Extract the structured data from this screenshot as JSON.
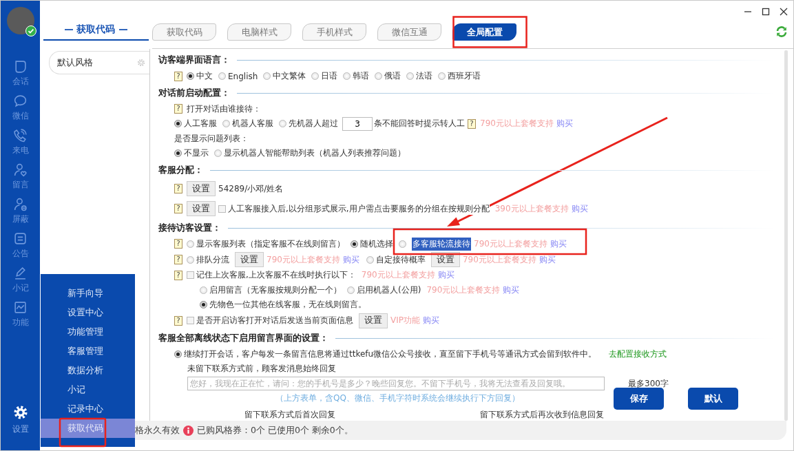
{
  "sidebar": {
    "items": [
      {
        "label": "会话"
      },
      {
        "label": "微信"
      },
      {
        "label": "来电"
      },
      {
        "label": "留言"
      },
      {
        "label": "屏蔽"
      },
      {
        "label": "公告"
      },
      {
        "label": "小记"
      },
      {
        "label": "功能"
      }
    ],
    "settings": {
      "label": "设置"
    }
  },
  "popup_menu": [
    {
      "label": "新手向导",
      "selected": false
    },
    {
      "label": "设置中心",
      "selected": false
    },
    {
      "label": "功能管理",
      "selected": false
    },
    {
      "label": "客服管理",
      "selected": false
    },
    {
      "label": "数据分析",
      "selected": false
    },
    {
      "label": "小记",
      "selected": false
    },
    {
      "label": "记录中心",
      "selected": false
    },
    {
      "label": "获取代码",
      "selected": true
    }
  ],
  "left_panel": {
    "title": "— 获取代码 —",
    "styles": [
      {
        "label": "默认风格"
      }
    ]
  },
  "tabs": [
    {
      "label": "获取代码",
      "selected": false
    },
    {
      "label": "电脑样式",
      "selected": false
    },
    {
      "label": "手机样式",
      "selected": false
    },
    {
      "label": "微信互通",
      "selected": false
    },
    {
      "label": "全局配置",
      "selected": true
    }
  ],
  "sections": [
    {
      "title": "访客端界面语言：",
      "rows": [
        {
          "kind": "main",
          "items": [
            {
              "kind": "help",
              "text": "?"
            },
            {
              "kind": "radio",
              "label": "中文",
              "selected": true
            },
            {
              "kind": "radio",
              "label": "English",
              "selected": false
            },
            {
              "kind": "radio",
              "label": "中文繁体",
              "selected": false
            },
            {
              "kind": "radio",
              "label": "日语",
              "selected": false
            },
            {
              "kind": "radio",
              "label": "韩语",
              "selected": false
            },
            {
              "kind": "radio",
              "label": "俄语",
              "selected": false
            },
            {
              "kind": "radio",
              "label": "法语",
              "selected": false
            },
            {
              "kind": "radio",
              "label": "西班牙语",
              "selected": false
            }
          ]
        }
      ]
    },
    {
      "title": "对话前启动配置：",
      "rows": [
        {
          "kind": "main",
          "items": [
            {
              "kind": "help",
              "text": "?"
            },
            {
              "kind": "text",
              "text": "打开对话由谁接待："
            }
          ]
        },
        {
          "kind": "main",
          "items": [
            {
              "kind": "radio",
              "label": "人工客服",
              "selected": true
            },
            {
              "kind": "radio",
              "label": "机器人客服",
              "selected": false
            },
            {
              "kind": "radio",
              "label": "先机器人超过",
              "selected": false
            },
            {
              "kind": "input",
              "value": "3"
            },
            {
              "kind": "text",
              "text": "条不能回答时提示转人工"
            },
            {
              "kind": "help",
              "text": "?"
            },
            {
              "kind": "promo",
              "text": "790元以上套餐支持"
            },
            {
              "kind": "link",
              "text": "购买"
            }
          ]
        },
        {
          "kind": "main",
          "items": [
            {
              "kind": "text",
              "text": "是否显示问题列表："
            }
          ]
        },
        {
          "kind": "main",
          "items": [
            {
              "kind": "radio",
              "label": "不显示",
              "selected": true
            },
            {
              "kind": "radio",
              "label": "显示机器人智能帮助列表（机器人列表推荐问题）",
              "selected": false
            }
          ]
        }
      ]
    },
    {
      "title": "客服分配：",
      "rows": [
        {
          "kind": "tall",
          "items": [
            {
              "kind": "help",
              "text": "?"
            },
            {
              "kind": "button",
              "label": "设置"
            },
            {
              "kind": "text",
              "text": "54289/小邓/姓名"
            }
          ]
        },
        {
          "kind": "tall",
          "items": [
            {
              "kind": "help",
              "text": "?"
            },
            {
              "kind": "button",
              "label": "设置"
            },
            {
              "kind": "checkbox",
              "label": "人工客服接入后,以分组形式展示,用户需点击要服务的分组在按规则分配",
              "checked": false
            },
            {
              "kind": "promo",
              "text": "390元以上套餐支持"
            },
            {
              "kind": "link",
              "text": "购买"
            }
          ]
        }
      ]
    },
    {
      "title": "接待访客设置：",
      "rows": [
        {
          "kind": "main",
          "items": [
            {
              "kind": "help",
              "text": "?"
            },
            {
              "kind": "radio",
              "label": "显示客服列表（指定客服不在线则留言）",
              "selected": false
            },
            {
              "kind": "radio",
              "label": "随机选择",
              "selected": true
            },
            {
              "kind": "radio",
              "selected": false
            },
            {
              "kind": "highlight",
              "text": "多客服轮流接待"
            },
            {
              "kind": "promo",
              "text": "790元以上套餐支持"
            },
            {
              "kind": "link",
              "text": "购买"
            }
          ]
        },
        {
          "kind": "main",
          "items": [
            {
              "kind": "help",
              "text": "?"
            },
            {
              "kind": "radio",
              "label": "排队分流",
              "selected": false
            },
            {
              "kind": "button",
              "label": "设置"
            },
            {
              "kind": "promo",
              "text": "790元以上套餐支持"
            },
            {
              "kind": "link",
              "text": "购买"
            },
            {
              "kind": "radio",
              "label": "自定接待概率",
              "selected": false
            },
            {
              "kind": "button",
              "label": "设置"
            },
            {
              "kind": "promo",
              "text": "790元以上套餐支持"
            },
            {
              "kind": "link",
              "text": "购买"
            }
          ]
        },
        {
          "kind": "main",
          "items": [
            {
              "kind": "help",
              "text": "?"
            },
            {
              "kind": "checkbox",
              "label": "记住上次客服,上次客服不在线时执行以下：",
              "checked": false
            },
            {
              "kind": "promo",
              "text": "790元以上套餐支持"
            },
            {
              "kind": "link",
              "text": "购买"
            }
          ]
        },
        {
          "kind": "sub",
          "items": [
            {
              "kind": "radio",
              "label": "启用留言（无客服按规则分配一个）",
              "selected": false
            },
            {
              "kind": "radio",
              "label": "启用机器人(公用)",
              "selected": false
            },
            {
              "kind": "promo",
              "text": "790元以上套餐支持"
            },
            {
              "kind": "link",
              "text": "购买"
            }
          ]
        },
        {
          "kind": "sub",
          "items": [
            {
              "kind": "radio",
              "label": "先物色一位其他在线客服，无在线则留言。",
              "selected": true
            }
          ]
        },
        {
          "kind": "main",
          "items": [
            {
              "kind": "help",
              "text": "?"
            },
            {
              "kind": "checkbox",
              "label": "是否开启访客打开对话后发送当前页面信息",
              "checked": false
            },
            {
              "kind": "button",
              "label": "设置"
            },
            {
              "kind": "promo",
              "text": "VIP功能"
            },
            {
              "kind": "link",
              "text": "购买"
            }
          ]
        }
      ]
    },
    {
      "title": "客服全部离线状态下启用留言界面的设置：",
      "rows": [
        {
          "kind": "main",
          "items": [
            {
              "kind": "radio",
              "label": "继续打开会话，客户每发一条留言信息将通过ttkefu微信公众号接收，直至留下手机号等通讯方式会留到软件中。",
              "selected": true
            },
            {
              "kind": "config-link",
              "text": "去配置接收方式"
            }
          ]
        },
        {
          "kind": "detail",
          "items": [
            {
              "kind": "text",
              "text": "未留下联系方式前，顾客发消息始终回复"
            }
          ]
        },
        {
          "kind": "detail",
          "items": [
            {
              "kind": "textbox",
              "placeholder": "您好，我现在正在忙，请问：您的手机号是多少？晚些回复您。不留下手机号，我将无法查看及回复哦。"
            },
            {
              "kind": "text",
              "text": "最多300字"
            }
          ]
        },
        {
          "kind": "note",
          "items": [
            {
              "kind": "note",
              "text": "（上方表单，含QQ、微信、手机字符时系统会继续执行下方回复）"
            }
          ]
        },
        {
          "kind": "split",
          "items": [
            {
              "kind": "text",
              "text": "留下联系方式后首次回复"
            },
            {
              "kind": "text",
              "text": "留下联系方式后再次收到信息回复"
            }
          ]
        }
      ]
    }
  ],
  "actions": [
    {
      "label": "保存"
    },
    {
      "label": "默认"
    }
  ],
  "status_bar": {
    "validity": "格永久有效",
    "coupons": "已购风格券：0个 已使用0个 剩余0个。"
  }
}
